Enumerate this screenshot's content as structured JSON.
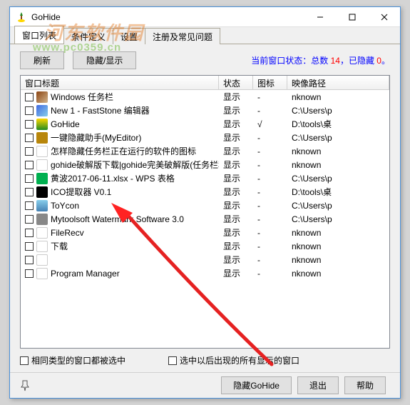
{
  "titlebar": {
    "title": "GoHide"
  },
  "watermark": {
    "line1": "河东软件园",
    "line2": "www.pc0359.cn"
  },
  "tabs": [
    {
      "label": "窗口列表",
      "active": true
    },
    {
      "label": "条件定义",
      "active": false
    },
    {
      "label": "设置",
      "active": false
    },
    {
      "label": "注册及常见问题",
      "active": false
    }
  ],
  "toolbar": {
    "refresh_label": "刷新",
    "hide_show_label": "隐藏/显示",
    "status_prefix": "当前窗口状态：",
    "status_total_label": "总数 ",
    "status_total_value": "14",
    "status_sep": "，",
    "status_hidden_label": "已隐藏 ",
    "status_hidden_value": "0",
    "status_suffix": "。"
  },
  "columns": {
    "title": "窗口标题",
    "state": "状态",
    "icon": "图标",
    "path": "映像路径"
  },
  "rows": [
    {
      "title": "Windows 任务栏",
      "state": "显示",
      "icon": "-",
      "path": "nknown",
      "iconCls": "ic-taskbar"
    },
    {
      "title": "New 1 - FastStone 编辑器",
      "state": "显示",
      "icon": "-",
      "path": "C:\\Users\\p",
      "iconCls": "ic-faststone"
    },
    {
      "title": "GoHide",
      "state": "显示",
      "icon": "√",
      "path": "D:\\tools\\桌",
      "iconCls": "ic-gohide"
    },
    {
      "title": "一键隐藏助手(MyEditor)",
      "state": "显示",
      "icon": "-",
      "path": "C:\\Users\\p",
      "iconCls": "ic-myeditor"
    },
    {
      "title": "怎样隐藏任务栏正在运行的软件的图标",
      "state": "显示",
      "icon": "-",
      "path": "nknown",
      "iconCls": "ic-blank"
    },
    {
      "title": "gohide破解版下载|gohide完美破解版(任务栏程序一键...",
      "state": "显示",
      "icon": "-",
      "path": "nknown",
      "iconCls": "ic-blank"
    },
    {
      "title": "黄波2017-06-11.xlsx - WPS 表格",
      "state": "显示",
      "icon": "-",
      "path": "C:\\Users\\p",
      "iconCls": "ic-wps"
    },
    {
      "title": "ICO提取器 V0.1",
      "state": "显示",
      "icon": "-",
      "path": "D:\\tools\\桌",
      "iconCls": "ic-ico"
    },
    {
      "title": "ToYcon",
      "state": "显示",
      "icon": "-",
      "path": "C:\\Users\\p",
      "iconCls": "ic-toycon"
    },
    {
      "title": "Mytoolsoft Watermark Software 3.0",
      "state": "显示",
      "icon": "-",
      "path": "C:\\Users\\p",
      "iconCls": "ic-mytoolsoft"
    },
    {
      "title": "FileRecv",
      "state": "显示",
      "icon": "-",
      "path": "nknown",
      "iconCls": "ic-blank"
    },
    {
      "title": "下载",
      "state": "显示",
      "icon": "-",
      "path": "nknown",
      "iconCls": "ic-blank"
    },
    {
      "title": "",
      "state": "显示",
      "icon": "-",
      "path": "nknown",
      "iconCls": "ic-blank"
    },
    {
      "title": "Program Manager",
      "state": "显示",
      "icon": "-",
      "path": "nknown",
      "iconCls": "ic-blank"
    }
  ],
  "options": {
    "same_type": "相同类型的窗口都被选中",
    "after_show": "选中以后出现的所有显示的窗口"
  },
  "bottom": {
    "hide_gohide": "隐藏GoHide",
    "exit": "退出",
    "help": "帮助"
  }
}
